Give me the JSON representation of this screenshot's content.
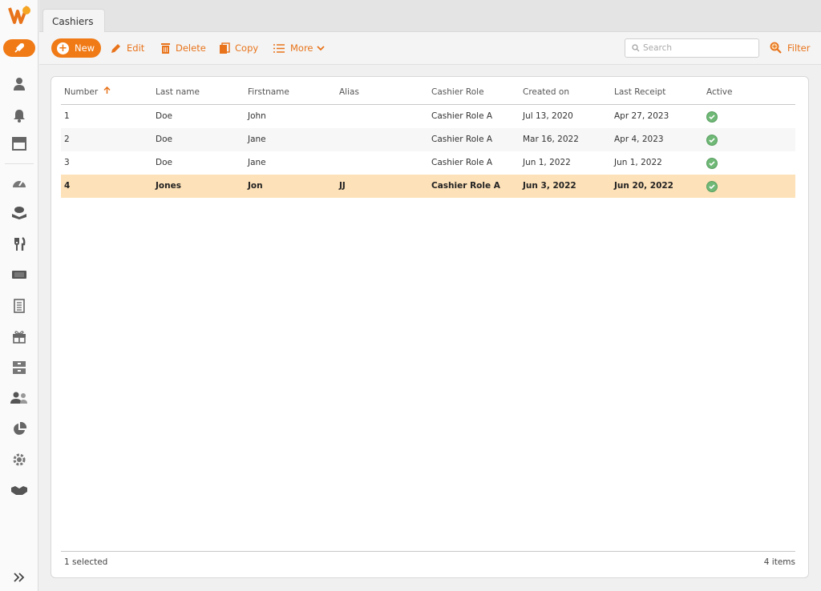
{
  "tabs": [
    {
      "label": "Cashiers"
    }
  ],
  "toolbar": {
    "new_label": "New",
    "edit_label": "Edit",
    "delete_label": "Delete",
    "copy_label": "Copy",
    "more_label": "More",
    "filter_label": "Filter",
    "search_placeholder": "Search"
  },
  "table": {
    "columns": [
      "Number",
      "Last name",
      "Firstname",
      "Alias",
      "Cashier Role",
      "Created on",
      "Last Receipt",
      "Active"
    ],
    "sort_icon": "arrow-up-icon",
    "rows": [
      {
        "number": "1",
        "last_name": "Doe",
        "firstname": "John",
        "alias": "",
        "role": "Cashier Role A",
        "created": "Jul 13, 2020",
        "last_receipt": "Apr 27, 2023",
        "active": true
      },
      {
        "number": "2",
        "last_name": "Doe",
        "firstname": "Jane",
        "alias": "",
        "role": "Cashier Role A",
        "created": "Mar 16, 2022",
        "last_receipt": "Apr 4, 2023",
        "active": true
      },
      {
        "number": "3",
        "last_name": "Doe",
        "firstname": "Jane",
        "alias": "",
        "role": "Cashier Role A",
        "created": "Jun 1, 2022",
        "last_receipt": "Jun 1, 2022",
        "active": true
      },
      {
        "number": "4",
        "last_name": "Jones",
        "firstname": "Jon",
        "alias": "JJ",
        "role": "Cashier Role A",
        "created": "Jun 3, 2022",
        "last_receipt": "Jun 20, 2022",
        "active": true
      }
    ]
  },
  "footer": {
    "selected": "1 selected",
    "count": "4 items"
  },
  "colors": {
    "accent": "#f07a16",
    "selected_row": "#fde1b8",
    "active_check": "#6fb876"
  },
  "sidebar_icons": [
    "logo-icon",
    "rocket-icon",
    "user-icon",
    "bell-icon",
    "store-icon",
    "dashboard-icon",
    "cash-icon",
    "cutlery-icon",
    "ticket-icon",
    "receipt-icon",
    "gift-icon",
    "drawer-icon",
    "users-icon",
    "pie-chart-icon",
    "gear-icon",
    "handshake-icon",
    "expand-icon"
  ]
}
